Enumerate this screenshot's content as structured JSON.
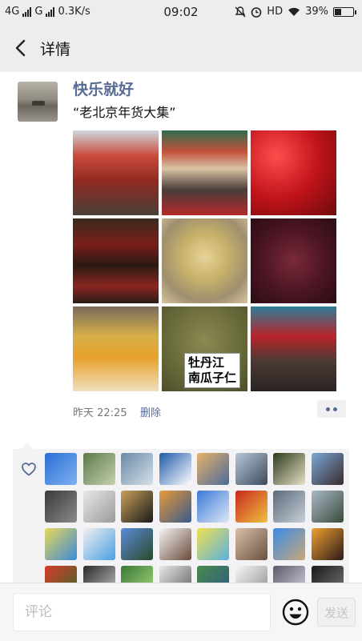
{
  "status_bar": {
    "network1": "4G",
    "network2": "G",
    "speed": "0.3K/s",
    "time": "09:02",
    "hd": "HD",
    "battery": "39%",
    "battery_level": 0.39
  },
  "header": {
    "title": "详情"
  },
  "post": {
    "username": "快乐就好",
    "text": "“老北京年货大集”",
    "time": "昨天 22:25",
    "delete_label": "删除",
    "photos": [
      {
        "bg": "linear-gradient(180deg,#cfd7de 0%,#c94a3a 30%,#8e2a22 60%,#4a4038 100%)",
        "caption": ""
      },
      {
        "bg": "linear-gradient(180deg,#2f6d4f 0%,#c2513b 25%,#d9c4a6 45%,#4a3d3a 70%,#b32a2a 100%)",
        "caption": ""
      },
      {
        "bg": "radial-gradient(circle at 30% 30%,#ff4d4d 0%,#c0141a 50%,#6e0a0e 100%)",
        "caption": ""
      },
      {
        "bg": "linear-gradient(180deg,#3a2a1e 0%,#7a1e1a 30%,#2a1a12 55%,#8a2622 80%,#2a1c14 100%)",
        "caption": ""
      },
      {
        "bg": "radial-gradient(circle at 50% 45%,#e7d39b 0%,#c9b36a 35%,#9e8f6f 70%,#d8c6a0 100%)",
        "caption": ""
      },
      {
        "bg": "radial-gradient(circle at 50% 50%,#7a2a3a 0%,#4e1624 50%,#2a0c14 100%)",
        "caption": ""
      },
      {
        "bg": "linear-gradient(180deg,#7a6a5a 0%,#d6b04a 35%,#e8a02a 60%,#f0e0c0 100%)",
        "caption": ""
      },
      {
        "bg": "radial-gradient(circle at 50% 40%,#8a8a52 0%,#6c6d3c 50%,#4e4f2a 100%)",
        "caption": ""
      },
      {
        "bg": "linear-gradient(180deg,#2d7d9a 0%,#b8242a 35%,#4a3a34 65%,#2a2422 100%)",
        "caption": ""
      }
    ],
    "sign_text_line1": "牡丹江",
    "sign_text_line2": "南瓜子仁"
  },
  "likes": {
    "avatars": [
      "linear-gradient(135deg,#2a6fd6,#7fb0f0)",
      "linear-gradient(135deg,#5d7a4a,#c6d1b0)",
      "linear-gradient(135deg,#6a8aa8,#d6e0e8)",
      "linear-gradient(135deg,#1e5aa8,#ffffff)",
      "linear-gradient(135deg,#e8b26a,#4a6a9a)",
      "linear-gradient(135deg,#b8c8d8,#3a4a5a)",
      "linear-gradient(135deg,#2a3a1a,#e8e0c8)",
      "linear-gradient(135deg,#7aa8d8,#3a2a2a)",
      "linear-gradient(135deg,#3a3a3a,#8a8a8a)",
      "linear-gradient(135deg,#e8e8e8,#9a9a9a)",
      "linear-gradient(135deg,#c8a05a,#1a1a1a)",
      "linear-gradient(135deg,#e89a3a,#3a5a8a)",
      "linear-gradient(135deg,#3a7ad8,#dde8f5)",
      "linear-gradient(135deg,#c8281e,#f0c040)",
      "linear-gradient(135deg,#5a6a7a,#c8d0d8)",
      "linear-gradient(135deg,#a8b8c8,#3a4a3a)",
      "linear-gradient(135deg,#e8d85a,#3a8ad8)",
      "linear-gradient(135deg,#f0f0f0,#4aa0e0)",
      "linear-gradient(135deg,#5a8ad8,#2a4a2a)",
      "linear-gradient(135deg,#f5f5f5,#6a4a3a)",
      "linear-gradient(135deg,#f0e050,#5ab0e0)",
      "linear-gradient(135deg,#d8c0a8,#6a5040)",
      "linear-gradient(135deg,#3a8ae8,#c8a878)",
      "linear-gradient(135deg,#f0a030,#2a1a1a)",
      "linear-gradient(135deg,#d83a2a,#3a6a2a)",
      "linear-gradient(135deg,#2a2a2a,#c8c8c8)",
      "linear-gradient(135deg,#3a7a3a,#a8d878)",
      "linear-gradient(135deg,#e8e8e8,#5a5a5a)",
      "linear-gradient(135deg,#4a8a4a,#2a5a8a)",
      "linear-gradient(135deg,#f8f8f8,#8a8a8a)",
      "linear-gradient(135deg,#5a5a6a,#d8d8e8)",
      "linear-gradient(135deg,#1a1a1a,#7a7a7a)"
    ]
  },
  "comment": {
    "placeholder": "评论",
    "send_label": "发送"
  }
}
